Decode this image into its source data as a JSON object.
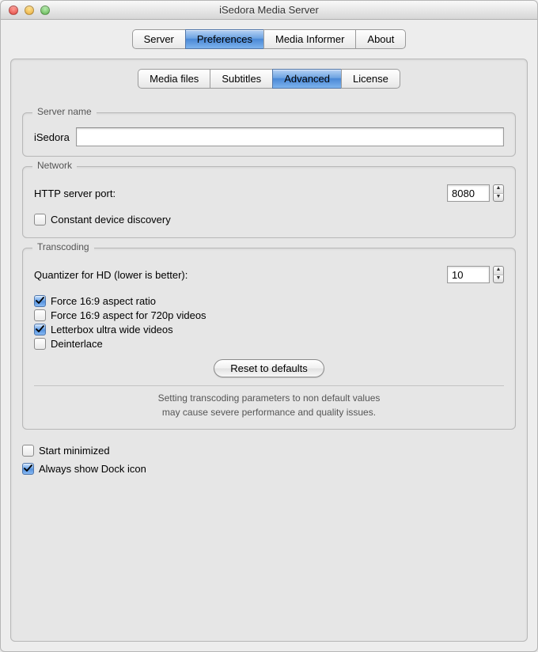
{
  "window": {
    "title": "iSedora Media Server"
  },
  "mainTabs": {
    "items": [
      {
        "label": "Server",
        "active": false
      },
      {
        "label": "Preferences",
        "active": true
      },
      {
        "label": "Media Informer",
        "active": false
      },
      {
        "label": "About",
        "active": false
      }
    ]
  },
  "subTabs": {
    "items": [
      {
        "label": "Media files",
        "active": false
      },
      {
        "label": "Subtitles",
        "active": false
      },
      {
        "label": "Advanced",
        "active": true
      },
      {
        "label": "License",
        "active": false
      }
    ]
  },
  "serverName": {
    "legend": "Server name",
    "label": "iSedora",
    "value": ""
  },
  "network": {
    "legend": "Network",
    "httpPortLabel": "HTTP server port:",
    "httpPortValue": "8080",
    "constantDiscovery": {
      "label": "Constant device discovery",
      "checked": false
    }
  },
  "transcoding": {
    "legend": "Transcoding",
    "quantizerLabel": "Quantizer for HD (lower is better):",
    "quantizerValue": "10",
    "force169": {
      "label": "Force 16:9 aspect ratio",
      "checked": true
    },
    "force169_720p": {
      "label": "Force 16:9 aspect for 720p videos",
      "checked": false
    },
    "letterbox": {
      "label": "Letterbox ultra wide videos",
      "checked": true
    },
    "deinterlace": {
      "label": "Deinterlace",
      "checked": false
    },
    "resetButton": "Reset to defaults",
    "note1": "Setting transcoding parameters to non default values",
    "note2": "may cause severe performance and quality issues."
  },
  "misc": {
    "startMinimized": {
      "label": "Start minimized",
      "checked": false
    },
    "showDockIcon": {
      "label": "Always show Dock icon",
      "checked": true
    }
  }
}
